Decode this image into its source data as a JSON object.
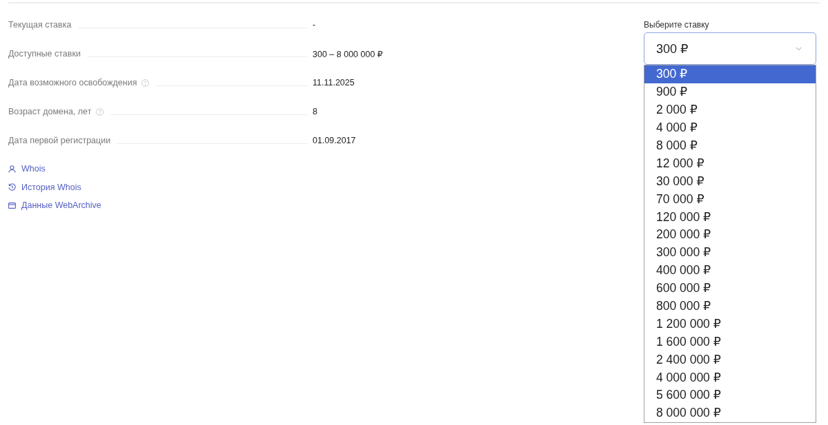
{
  "details": {
    "rows": [
      {
        "label": "Текущая ставка",
        "help": false,
        "value": "-"
      },
      {
        "label": "Доступные ставки",
        "help": false,
        "value": "300 – 8 000 000 ₽"
      },
      {
        "label": "Дата возможного освобождения",
        "help": true,
        "value": "11.11.2025"
      },
      {
        "label": "Возраст домена, лет",
        "help": true,
        "value": "8"
      },
      {
        "label": "Дата первой регистрации",
        "help": false,
        "value": "01.09.2017"
      }
    ],
    "links": [
      {
        "kind": "person",
        "label": "Whois"
      },
      {
        "kind": "history",
        "label": "История Whois"
      },
      {
        "kind": "window",
        "label": "Данные WebArchive"
      }
    ]
  },
  "bid_select": {
    "label": "Выберите ставку",
    "value": "300 ₽",
    "expanded": true,
    "options": [
      {
        "label": "300 ₽",
        "selected": true
      },
      {
        "label": "900 ₽",
        "selected": false
      },
      {
        "label": "2 000 ₽",
        "selected": false
      },
      {
        "label": "4 000 ₽",
        "selected": false
      },
      {
        "label": "8 000 ₽",
        "selected": false
      },
      {
        "label": "12 000 ₽",
        "selected": false
      },
      {
        "label": "30 000 ₽",
        "selected": false
      },
      {
        "label": "70 000 ₽",
        "selected": false
      },
      {
        "label": "120 000 ₽",
        "selected": false
      },
      {
        "label": "200 000 ₽",
        "selected": false
      },
      {
        "label": "300 000 ₽",
        "selected": false
      },
      {
        "label": "400 000 ₽",
        "selected": false
      },
      {
        "label": "600 000 ₽",
        "selected": false
      },
      {
        "label": "800 000 ₽",
        "selected": false
      },
      {
        "label": "1 200 000 ₽",
        "selected": false
      },
      {
        "label": "1 600 000 ₽",
        "selected": false
      },
      {
        "label": "2 400 000 ₽",
        "selected": false
      },
      {
        "label": "4 000 000 ₽",
        "selected": false
      },
      {
        "label": "5 600 000 ₽",
        "selected": false
      },
      {
        "label": "8 000 000 ₽",
        "selected": false
      }
    ]
  }
}
